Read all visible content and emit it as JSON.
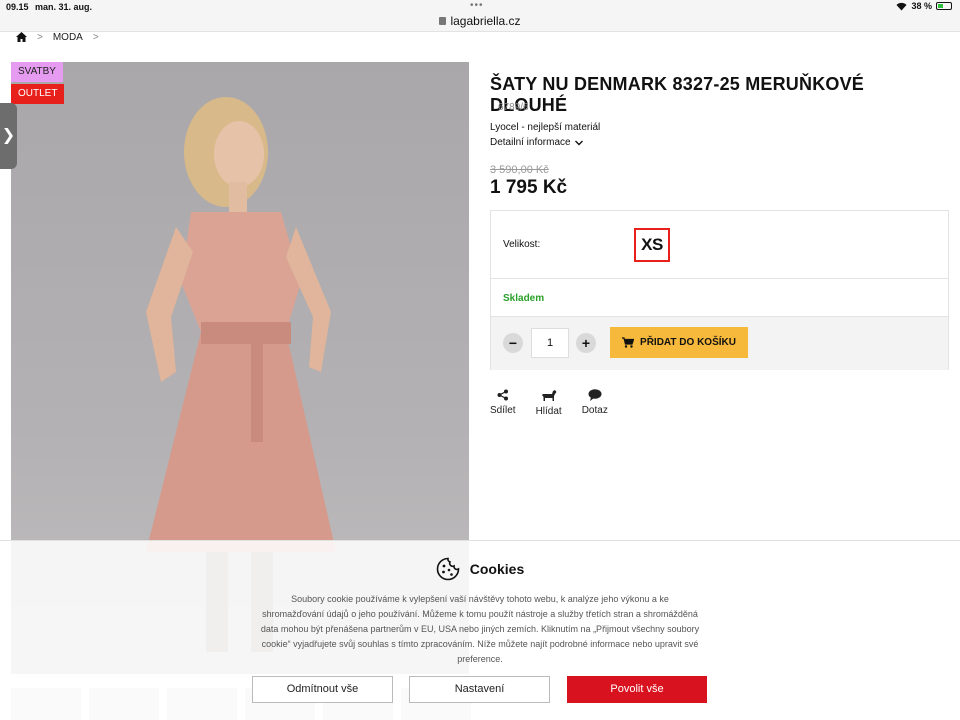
{
  "status_bar": {
    "time": "09.15",
    "date": "man. 31. aug.",
    "url": "lagabriella.cz",
    "battery": "38 %"
  },
  "breadcrumb": {
    "items": [
      "MODA"
    ],
    "separator": ">"
  },
  "badges": [
    "SVATBY",
    "OUTLET"
  ],
  "product": {
    "title": "ŠATY NU DENMARK 8327-25 MERUŇKOVÉ DLOUHÉ",
    "code": "6789/6",
    "material": "Lyocel - nejlepší materiál",
    "details_label": "Detailní informace",
    "old_price": "3 590,00 Kč",
    "price": "1 795 Kč",
    "size_label": "Velikost:",
    "size_selected": "XS",
    "stock": "Skladem",
    "quantity": "1",
    "add_to_cart": "PŘIDAT DO KOŠÍKU"
  },
  "actions": [
    {
      "label": "Sdílet",
      "icon": "share-icon"
    },
    {
      "label": "Hlídat",
      "icon": "watchdog-icon"
    },
    {
      "label": "Dotaz",
      "icon": "chat-icon"
    }
  ],
  "cookie": {
    "title": "Cookies",
    "text": "Soubory cookie používáme k vylepšení vaší návštěvy tohoto webu, k analýze jeho výkonu a ke shromažďování údajů o jeho používání. Můžeme k tomu použít nástroje a služby třetích stran a shromážděná data mohou být přenášena partnerům v EU, USA nebo jiných zemích. Kliknutím na „Přijmout všechny soubory cookie“ vyjadřujete svůj souhlas s tímto zpracováním. Níže můžete najít podrobné informace nebo upravit své preference.",
    "reject": "Odmítnout vše",
    "settings": "Nastavení",
    "allow": "Povolit vše"
  },
  "colors": {
    "accent_red": "#d9121f",
    "cart_yellow": "#f6b93b",
    "stock_green": "#2aa02a",
    "badge_pink": "#e59cf0"
  }
}
